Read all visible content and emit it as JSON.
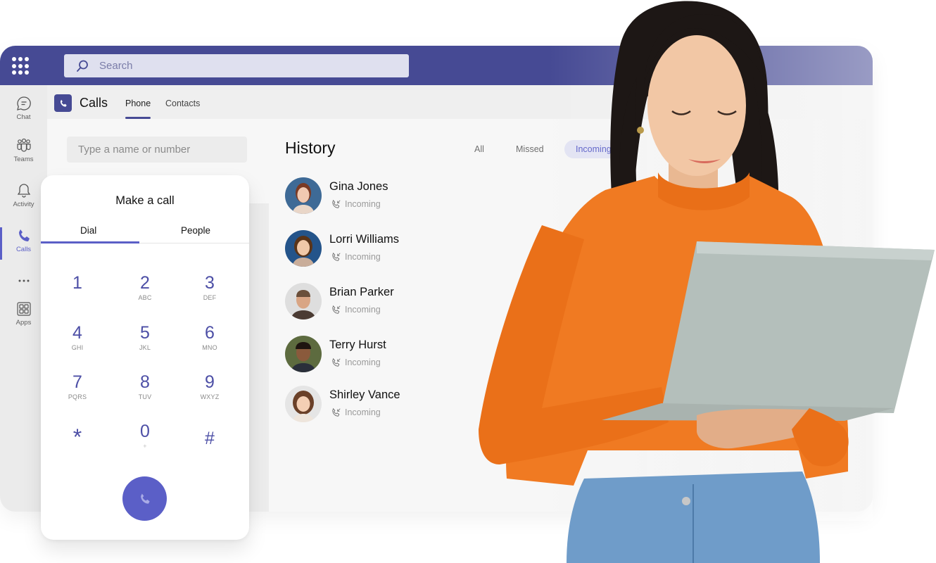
{
  "topbar": {
    "apps_icon": "waffle-grid-icon",
    "search": {
      "placeholder": "Search",
      "icon": "search-icon"
    }
  },
  "rail": {
    "items": [
      {
        "label": "Chat",
        "icon": "chat-icon",
        "active": false
      },
      {
        "label": "Teams",
        "icon": "teams-icon",
        "active": false
      },
      {
        "label": "Activity",
        "icon": "bell-icon",
        "active": false
      },
      {
        "label": "Calls",
        "icon": "phone-icon",
        "active": true
      },
      {
        "label": "",
        "icon": "more-icon",
        "active": false
      },
      {
        "label": "Apps",
        "icon": "apps-icon",
        "active": false
      }
    ]
  },
  "header": {
    "title": "Calls",
    "tabs": [
      {
        "label": "Phone",
        "active": true
      },
      {
        "label": "Contacts",
        "active": false
      }
    ]
  },
  "dial_input": {
    "placeholder": "Type a name or number"
  },
  "history": {
    "title": "History",
    "filters": [
      {
        "label": "All",
        "active": false
      },
      {
        "label": "Missed",
        "active": false
      },
      {
        "label": "Incoming",
        "active": true
      }
    ],
    "entries": [
      {
        "name": "Gina Jones",
        "status": "Incoming"
      },
      {
        "name": "Lorri Williams",
        "status": "Incoming"
      },
      {
        "name": "Brian Parker",
        "status": "Incoming"
      },
      {
        "name": "Terry Hurst",
        "status": "Incoming"
      },
      {
        "name": "Shirley Vance",
        "status": "Incoming"
      }
    ]
  },
  "make_call": {
    "title": "Make a call",
    "tabs": [
      {
        "label": "Dial",
        "active": true
      },
      {
        "label": "People",
        "active": false
      }
    ],
    "keys": [
      {
        "digit": "1",
        "letters": ""
      },
      {
        "digit": "2",
        "letters": "ABC"
      },
      {
        "digit": "3",
        "letters": "DEF"
      },
      {
        "digit": "4",
        "letters": "GHI"
      },
      {
        "digit": "5",
        "letters": "JKL"
      },
      {
        "digit": "6",
        "letters": "MNO"
      },
      {
        "digit": "7",
        "letters": "PQRS"
      },
      {
        "digit": "8",
        "letters": "TUV"
      },
      {
        "digit": "9",
        "letters": "WXYZ"
      },
      {
        "digit": "*",
        "letters": ""
      },
      {
        "digit": "0",
        "letters": "+"
      },
      {
        "digit": "#",
        "letters": ""
      }
    ],
    "call_button_icon": "phone-icon"
  },
  "colors": {
    "brand": "#464a94",
    "accent": "#5b5fc7",
    "sweater": "#f07a22",
    "jeans": "#6f9cc9"
  }
}
